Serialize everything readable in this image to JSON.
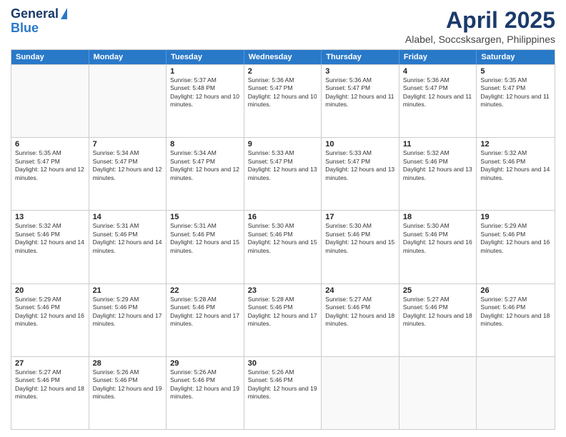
{
  "logo": {
    "line1": "General",
    "line2": "Blue"
  },
  "header": {
    "month": "April 2025",
    "location": "Alabel, Soccsksargen, Philippines"
  },
  "weekdays": [
    "Sunday",
    "Monday",
    "Tuesday",
    "Wednesday",
    "Thursday",
    "Friday",
    "Saturday"
  ],
  "rows": [
    [
      {
        "day": "",
        "info": ""
      },
      {
        "day": "",
        "info": ""
      },
      {
        "day": "1",
        "info": "Sunrise: 5:37 AM\nSunset: 5:48 PM\nDaylight: 12 hours and 10 minutes."
      },
      {
        "day": "2",
        "info": "Sunrise: 5:36 AM\nSunset: 5:47 PM\nDaylight: 12 hours and 10 minutes."
      },
      {
        "day": "3",
        "info": "Sunrise: 5:36 AM\nSunset: 5:47 PM\nDaylight: 12 hours and 11 minutes."
      },
      {
        "day": "4",
        "info": "Sunrise: 5:36 AM\nSunset: 5:47 PM\nDaylight: 12 hours and 11 minutes."
      },
      {
        "day": "5",
        "info": "Sunrise: 5:35 AM\nSunset: 5:47 PM\nDaylight: 12 hours and 11 minutes."
      }
    ],
    [
      {
        "day": "6",
        "info": "Sunrise: 5:35 AM\nSunset: 5:47 PM\nDaylight: 12 hours and 12 minutes."
      },
      {
        "day": "7",
        "info": "Sunrise: 5:34 AM\nSunset: 5:47 PM\nDaylight: 12 hours and 12 minutes."
      },
      {
        "day": "8",
        "info": "Sunrise: 5:34 AM\nSunset: 5:47 PM\nDaylight: 12 hours and 12 minutes."
      },
      {
        "day": "9",
        "info": "Sunrise: 5:33 AM\nSunset: 5:47 PM\nDaylight: 12 hours and 13 minutes."
      },
      {
        "day": "10",
        "info": "Sunrise: 5:33 AM\nSunset: 5:47 PM\nDaylight: 12 hours and 13 minutes."
      },
      {
        "day": "11",
        "info": "Sunrise: 5:32 AM\nSunset: 5:46 PM\nDaylight: 12 hours and 13 minutes."
      },
      {
        "day": "12",
        "info": "Sunrise: 5:32 AM\nSunset: 5:46 PM\nDaylight: 12 hours and 14 minutes."
      }
    ],
    [
      {
        "day": "13",
        "info": "Sunrise: 5:32 AM\nSunset: 5:46 PM\nDaylight: 12 hours and 14 minutes."
      },
      {
        "day": "14",
        "info": "Sunrise: 5:31 AM\nSunset: 5:46 PM\nDaylight: 12 hours and 14 minutes."
      },
      {
        "day": "15",
        "info": "Sunrise: 5:31 AM\nSunset: 5:46 PM\nDaylight: 12 hours and 15 minutes."
      },
      {
        "day": "16",
        "info": "Sunrise: 5:30 AM\nSunset: 5:46 PM\nDaylight: 12 hours and 15 minutes."
      },
      {
        "day": "17",
        "info": "Sunrise: 5:30 AM\nSunset: 5:46 PM\nDaylight: 12 hours and 15 minutes."
      },
      {
        "day": "18",
        "info": "Sunrise: 5:30 AM\nSunset: 5:46 PM\nDaylight: 12 hours and 16 minutes."
      },
      {
        "day": "19",
        "info": "Sunrise: 5:29 AM\nSunset: 5:46 PM\nDaylight: 12 hours and 16 minutes."
      }
    ],
    [
      {
        "day": "20",
        "info": "Sunrise: 5:29 AM\nSunset: 5:46 PM\nDaylight: 12 hours and 16 minutes."
      },
      {
        "day": "21",
        "info": "Sunrise: 5:29 AM\nSunset: 5:46 PM\nDaylight: 12 hours and 17 minutes."
      },
      {
        "day": "22",
        "info": "Sunrise: 5:28 AM\nSunset: 5:46 PM\nDaylight: 12 hours and 17 minutes."
      },
      {
        "day": "23",
        "info": "Sunrise: 5:28 AM\nSunset: 5:46 PM\nDaylight: 12 hours and 17 minutes."
      },
      {
        "day": "24",
        "info": "Sunrise: 5:27 AM\nSunset: 5:46 PM\nDaylight: 12 hours and 18 minutes."
      },
      {
        "day": "25",
        "info": "Sunrise: 5:27 AM\nSunset: 5:46 PM\nDaylight: 12 hours and 18 minutes."
      },
      {
        "day": "26",
        "info": "Sunrise: 5:27 AM\nSunset: 5:46 PM\nDaylight: 12 hours and 18 minutes."
      }
    ],
    [
      {
        "day": "27",
        "info": "Sunrise: 5:27 AM\nSunset: 5:46 PM\nDaylight: 12 hours and 18 minutes."
      },
      {
        "day": "28",
        "info": "Sunrise: 5:26 AM\nSunset: 5:46 PM\nDaylight: 12 hours and 19 minutes."
      },
      {
        "day": "29",
        "info": "Sunrise: 5:26 AM\nSunset: 5:46 PM\nDaylight: 12 hours and 19 minutes."
      },
      {
        "day": "30",
        "info": "Sunrise: 5:26 AM\nSunset: 5:46 PM\nDaylight: 12 hours and 19 minutes."
      },
      {
        "day": "",
        "info": ""
      },
      {
        "day": "",
        "info": ""
      },
      {
        "day": "",
        "info": ""
      }
    ]
  ]
}
